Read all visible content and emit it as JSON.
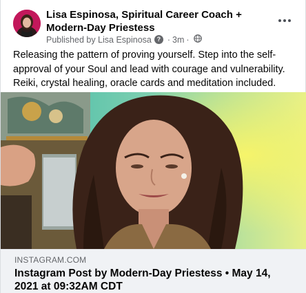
{
  "post": {
    "author_name": "Lisa Espinosa, Spiritual Career Coach + Modern-Day Priestess",
    "published_by": "Published by Lisa Espinosa",
    "help_icon_glyph": "?",
    "time_ago": "3m",
    "separator": "·",
    "audience_icon": "globe-icon",
    "more_icon": "more-options-icon",
    "caption": "Releasing the pattern of proving yourself. Step into the self-approval of your Soul and lead with courage and vulnerability. Reiki, crystal healing, oracle cards and meditation included."
  },
  "link_preview": {
    "domain": "INSTAGRAM.COM",
    "title": "Instagram Post by Modern-Day Priestess • May 14, 2021 at 09:32AM CDT"
  },
  "colors": {
    "text_primary": "#050505",
    "text_secondary": "#65676b",
    "footer_bg": "#f0f2f5",
    "avatar_bg": "#c2185b"
  }
}
